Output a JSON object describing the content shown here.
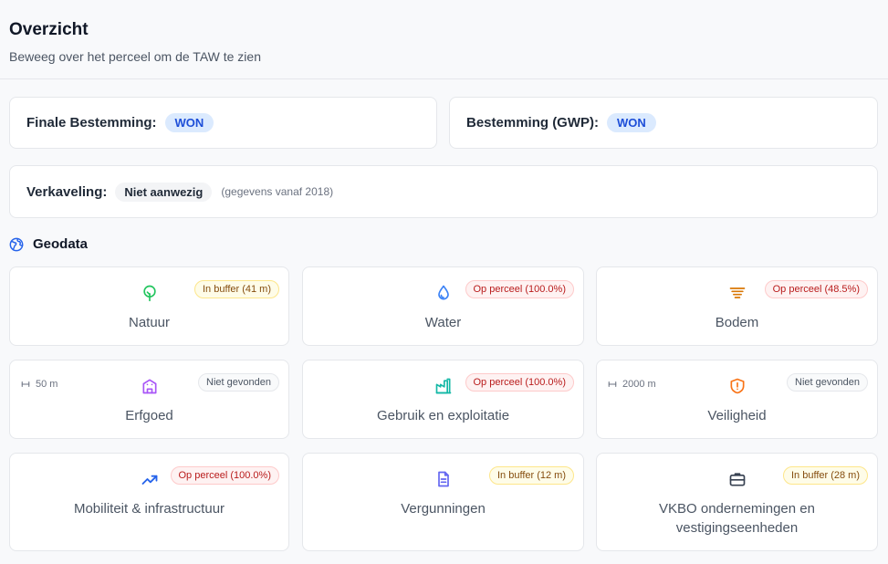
{
  "header": {
    "title": "Overzicht",
    "subtitle": "Beweeg over het perceel om de TAW te zien"
  },
  "finale": {
    "label": "Finale Bestemming:",
    "value": "WON"
  },
  "gwp": {
    "label": "Bestemming (GWP):",
    "value": "WON"
  },
  "verkaveling": {
    "label": "Verkaveling:",
    "value": "Niet aanwezig",
    "note": "(gegevens vanaf 2018)"
  },
  "geodata": {
    "title": "Geodata",
    "icon": "globe-icon",
    "tiles": [
      {
        "name": "Natuur",
        "badge": "In buffer (41 m)",
        "status": "buffer",
        "icon": "tree-icon",
        "color": "#22c55e"
      },
      {
        "name": "Water",
        "badge": "Op perceel (100.0%)",
        "status": "op",
        "icon": "droplet-icon",
        "color": "#3b82f6"
      },
      {
        "name": "Bodem",
        "badge": "Op perceel (48.5%)",
        "status": "op",
        "icon": "layers-icon",
        "color": "#d97706"
      },
      {
        "name": "Erfgoed",
        "badge": "Niet gevonden",
        "status": "none",
        "icon": "building-icon",
        "color": "#a855f7",
        "distance": "50 m"
      },
      {
        "name": "Gebruik en exploitatie",
        "badge": "Op perceel (100.0%)",
        "status": "op",
        "icon": "factory-icon",
        "color": "#14b8a6"
      },
      {
        "name": "Veiligheid",
        "badge": "Niet gevonden",
        "status": "none",
        "icon": "shield-alert-icon",
        "color": "#f97316",
        "distance": "2000 m"
      },
      {
        "name": "Mobiliteit & infrastructuur",
        "badge": "Op perceel (100.0%)",
        "status": "op",
        "icon": "trending-up-icon",
        "color": "#2563eb"
      },
      {
        "name": "Vergunningen",
        "badge": "In buffer (12 m)",
        "status": "buffer",
        "icon": "document-icon",
        "color": "#6366f1"
      },
      {
        "name": "VKBO ondernemingen en vestigingseenheden",
        "badge": "In buffer (28 m)",
        "status": "buffer",
        "icon": "briefcase-icon",
        "color": "#374151"
      }
    ]
  }
}
